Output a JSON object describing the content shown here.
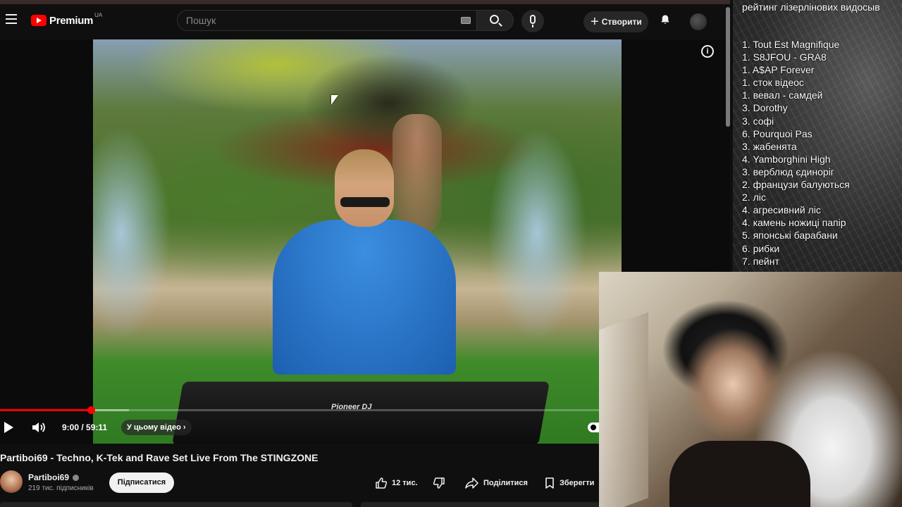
{
  "header": {
    "logo_text": "Premium",
    "region": "UA",
    "search_placeholder": "Пошук",
    "create_label": "Створити"
  },
  "player": {
    "time": "9:00 / 59:11",
    "chapters_label": "У цьому відео",
    "progress_fraction": 0.152,
    "buffered_fraction": 0.215,
    "brand_on_mixer": "Pioneer DJ",
    "accent_color": "#ff0000"
  },
  "video": {
    "title": "Partiboi69 - Techno, K-Tek and Rave Set Live From The STINGZONE",
    "channel_name": "Partiboi69",
    "subscribers": "219 тис. підписників",
    "subscribe_label": "Підписатися",
    "likes": "12 тис.",
    "share_label": "Поділитися",
    "save_label": "Зберегти"
  },
  "overlay_list": {
    "title": "рейтинг лізерлінових видосыв",
    "items": [
      "1. Tout Est Magnifique",
      "1. S8JFOU - GRA8",
      "1. A$AP Forever",
      "1. сток відеос",
      "1. вевал - самдей",
      "3. Dorothy",
      "3. софі",
      "6. Pourquoi Pas",
      "3. жабенята",
      "4. Yamborghini High",
      "3. верблюд єдиноріг",
      "2. французи балуються",
      "2. ліс",
      "4. агресивний ліс",
      "4. камень ножиці папір",
      "5. японські барабани",
      "6. рибки",
      "7. пейнт"
    ]
  },
  "icons": {
    "menu": "menu-icon",
    "search": "search-icon",
    "keyboard": "keyboard-icon",
    "mic": "mic-icon",
    "bell": "bell-icon",
    "info": "info-icon",
    "play": "play-icon",
    "volume": "volume-icon",
    "like": "thumbs-up-icon",
    "dislike": "thumbs-down-icon",
    "share": "share-icon",
    "save": "bookmark-icon"
  }
}
